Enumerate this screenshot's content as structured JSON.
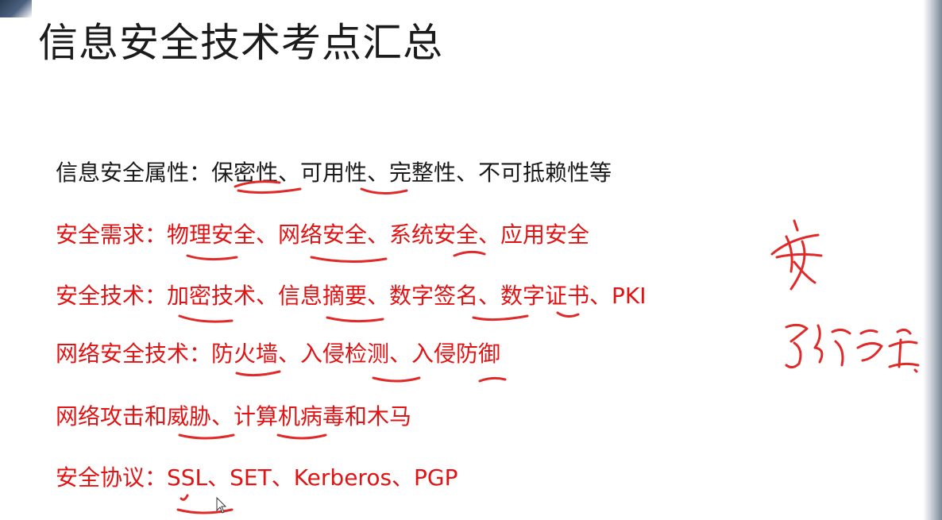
{
  "slide": {
    "title": "信息安全技术考点汇总",
    "lines": [
      "信息安全属性：保密性、可用性、完整性、不可抵赖性等",
      "安全需求：物理安全、网络安全、系统安全、应用安全",
      "安全技术：加密技术、信息摘要、数字签名、数字证书、PKI",
      "网络安全技术：防火墙、入侵检测、入侵防御",
      "网络攻击和威胁、计算机病毒和木马",
      "安全协议：SSL、SET、Kerberos、PGP"
    ]
  },
  "handwriting": [
    "安",
    "系统安全"
  ],
  "colors": {
    "title_text": "#1b1b1b",
    "body_text": "#1a1a1a",
    "highlight_text": "#e01414",
    "ink": "#e02a2a"
  },
  "icons": [
    "mouse-pointer-icon"
  ]
}
